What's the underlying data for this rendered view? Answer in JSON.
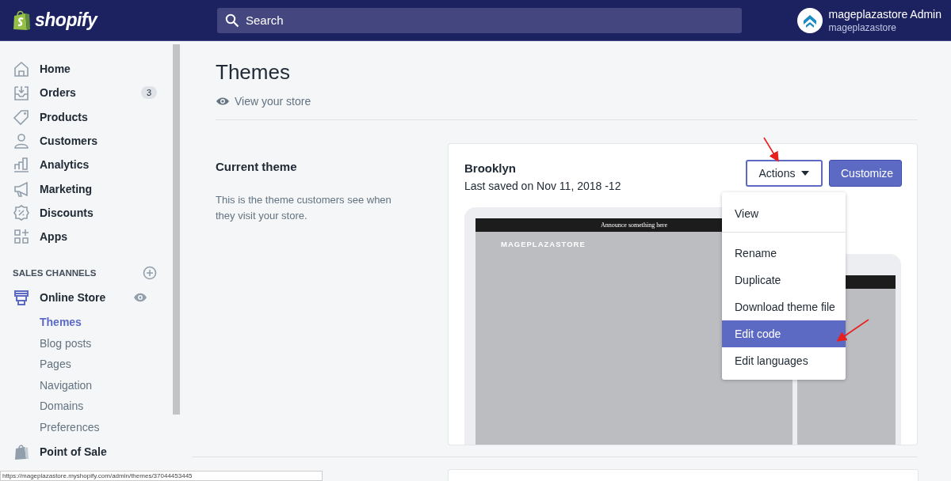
{
  "topbar": {
    "logo": "shopify",
    "search": {
      "placeholder": "Search"
    },
    "account": {
      "name": "mageplazastore Admin",
      "store": "mageplazastore"
    }
  },
  "sidebar": {
    "items": [
      {
        "label": "Home",
        "kind": "home"
      },
      {
        "label": "Orders",
        "kind": "orders",
        "badge": "3"
      },
      {
        "label": "Products",
        "kind": "products"
      },
      {
        "label": "Customers",
        "kind": "customers"
      },
      {
        "label": "Analytics",
        "kind": "analytics"
      },
      {
        "label": "Marketing",
        "kind": "marketing"
      },
      {
        "label": "Discounts",
        "kind": "discounts"
      },
      {
        "label": "Apps",
        "kind": "apps"
      }
    ],
    "sales_channels": {
      "heading": "SALES CHANNELS",
      "channels": [
        {
          "label": "Online Store",
          "kind": "store",
          "selected": true,
          "children": [
            {
              "label": "Themes",
              "selected": true
            },
            {
              "label": "Blog posts",
              "selected": false
            },
            {
              "label": "Pages",
              "selected": false
            },
            {
              "label": "Navigation",
              "selected": false
            },
            {
              "label": "Domains",
              "selected": false
            },
            {
              "label": "Preferences",
              "selected": false
            }
          ]
        },
        {
          "label": "Point of Sale",
          "kind": "pos",
          "selected": false
        }
      ]
    }
  },
  "page": {
    "title": "Themes",
    "view_store_link": "View your store",
    "current_theme": {
      "heading": "Current theme",
      "description": "This is the theme customers see when they visit your store.",
      "theme": {
        "name": "Brooklyn",
        "last_saved": "Last saved on Nov 11, 2018 -12",
        "actions_button": "Actions",
        "customize_button": "Customize",
        "preview": {
          "announcement": "Announce something here",
          "store_name": "MAGEPLAZASTORE"
        },
        "actions_menu": [
          [
            {
              "label": "View",
              "selected": false
            }
          ],
          [
            {
              "label": "Rename",
              "selected": false
            },
            {
              "label": "Duplicate",
              "selected": false
            },
            {
              "label": "Download theme file",
              "selected": false
            },
            {
              "label": "Edit code",
              "selected": true
            },
            {
              "label": "Edit languages",
              "selected": false
            }
          ]
        ]
      }
    }
  },
  "status_url": "https://mageplazastore.myshopify.com/admin/themes/37044453445"
}
